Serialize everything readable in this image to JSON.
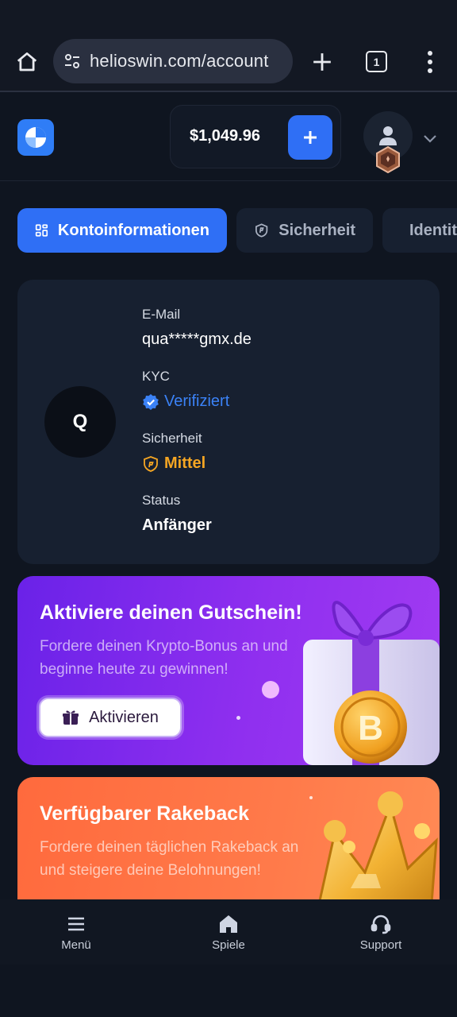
{
  "browser": {
    "url": "helioswin.com/account",
    "tab_count": "1"
  },
  "header": {
    "balance": "$1,049.96"
  },
  "tabs": [
    {
      "label": "Kontoinformationen",
      "active": true,
      "icon": "grid-icon"
    },
    {
      "label": "Sicherheit",
      "active": false,
      "icon": "shield-icon"
    },
    {
      "label": "Identität",
      "active": false,
      "icon": "id-card-icon"
    }
  ],
  "account": {
    "initial": "Q",
    "email_label": "E-Mail",
    "email_value": "qua*****gmx.de",
    "kyc_label": "KYC",
    "kyc_value": "Verifiziert",
    "security_label": "Sicherheit",
    "security_value": "Mittel",
    "status_label": "Status",
    "status_value": "Anfänger"
  },
  "promo_voucher": {
    "title": "Aktiviere deinen Gutschein!",
    "text": "Fordere deinen Krypto-Bonus an und beginne heute zu gewinnen!",
    "button": "Aktivieren"
  },
  "promo_rakeback": {
    "title": "Verfügbarer Rakeback",
    "text": "Fordere deinen täglichen Rakeback an und steigere deine Belohnungen!"
  },
  "bottom_nav": [
    {
      "label": "Menü",
      "icon": "menu-icon"
    },
    {
      "label": "Spiele",
      "icon": "home-icon"
    },
    {
      "label": "Support",
      "icon": "headset-icon"
    }
  ],
  "colors": {
    "accent": "#2f6ff5",
    "background": "#0f1520",
    "card": "#172030",
    "kyc": "#3b82f6",
    "security": "#f5a623"
  }
}
